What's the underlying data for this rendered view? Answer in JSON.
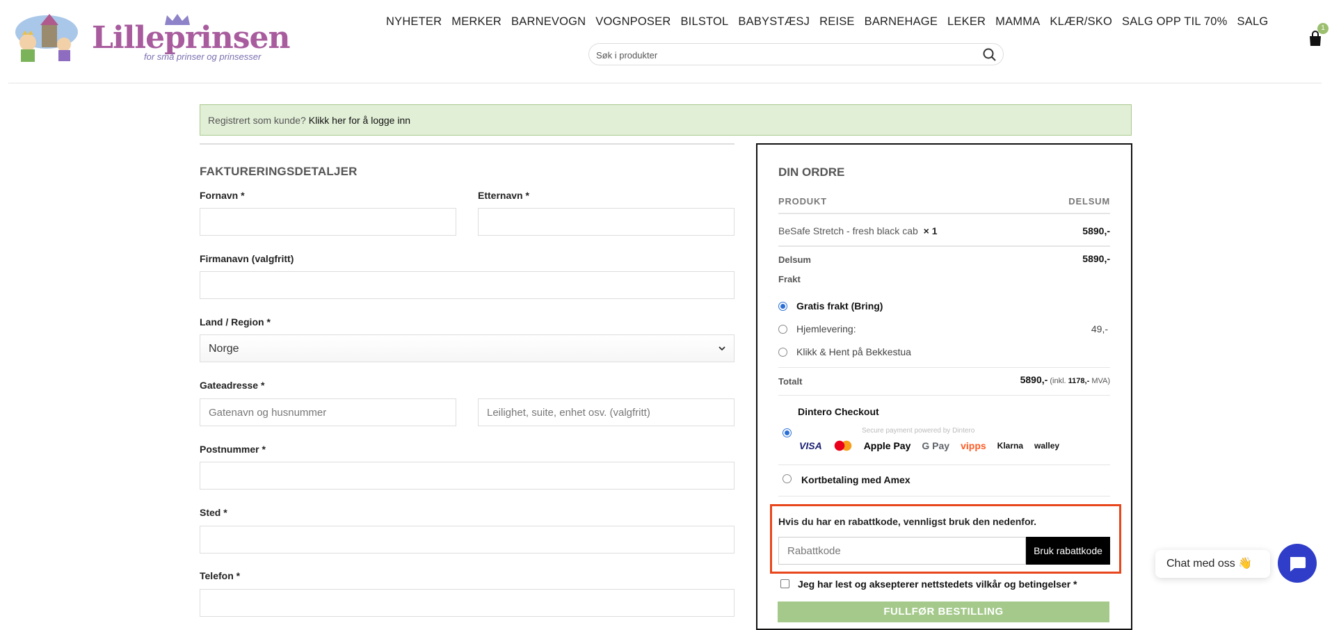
{
  "header": {
    "logo_text": "Lilleprinsen",
    "logo_tagline": "for små prinser og prinsesser",
    "nav": [
      "NYHETER",
      "MERKER",
      "BARNEVOGN",
      "VOGNPOSER",
      "BILSTOL",
      "BABYSTÆSJ",
      "REISE",
      "BARNEHAGE",
      "LEKER",
      "MAMMA",
      "KLÆR/SKO",
      "SALG OPP TIL 70%",
      "SALG"
    ],
    "search_placeholder": "Søk i produkter",
    "cart_count": "1"
  },
  "notice": {
    "text": "Registrert som kunde?",
    "link": "Klikk her for å logge inn"
  },
  "billing": {
    "title": "FAKTURERINGSDETALJER",
    "first_name_label": "Fornavn *",
    "last_name_label": "Etternavn *",
    "company_label": "Firmanavn (valgfritt)",
    "country_label": "Land / Region *",
    "country_value": "Norge",
    "street_label": "Gateadresse *",
    "street_placeholder": "Gatenavn og husnummer",
    "apt_placeholder": "Leilighet, suite, enhet osv. (valgfritt)",
    "postcode_label": "Postnummer *",
    "city_label": "Sted *",
    "phone_label": "Telefon *"
  },
  "order": {
    "title": "DIN ORDRE",
    "col_product": "PRODUKT",
    "col_subtotal": "DELSUM",
    "item_name": "BeSafe Stretch - fresh black cab",
    "item_qty": "× 1",
    "item_price": "5890,-",
    "subtotal_label": "Delsum",
    "subtotal_value": "5890,-",
    "shipping_label": "Frakt",
    "shipping_options": [
      {
        "label": "Gratis frakt (Bring)",
        "price": "",
        "selected": true
      },
      {
        "label": "Hjemlevering:",
        "price": "49,-",
        "selected": false
      },
      {
        "label": "Klikk & Hent på Bekkestua",
        "price": "",
        "selected": false
      }
    ],
    "total_label": "Totalt",
    "total_value": "5890,-",
    "total_vat_prefix": "(inkl.",
    "total_vat_amount": "1178,-",
    "total_vat_suffix": "MVA)",
    "payment_methods": [
      {
        "label": "Dintero Checkout",
        "selected": true
      },
      {
        "label": "Kortbetaling med Amex",
        "selected": false
      }
    ],
    "dintero_powered": "Secure payment powered by Dintero",
    "payment_logos": [
      "VISA",
      "mastercard",
      "Apple Pay",
      "G Pay",
      "vipps",
      "Klarna",
      "walley"
    ]
  },
  "coupon": {
    "text": "Hvis du har en rabattkode, vennligst bruk den nedenfor.",
    "placeholder": "Rabattkode",
    "button": "Bruk rabattkode"
  },
  "terms": "Jeg har lest og aksepterer nettstedets vilkår og betingelser *",
  "place_order": "FULLFØR BESTILLING",
  "chat": {
    "label": "Chat med oss",
    "emoji": "👋"
  },
  "colors": {
    "accent_green": "#a4c98b",
    "notice_bg": "#e2efd7",
    "highlight": "#e8461c",
    "chat_blue": "#2f3dc9"
  }
}
